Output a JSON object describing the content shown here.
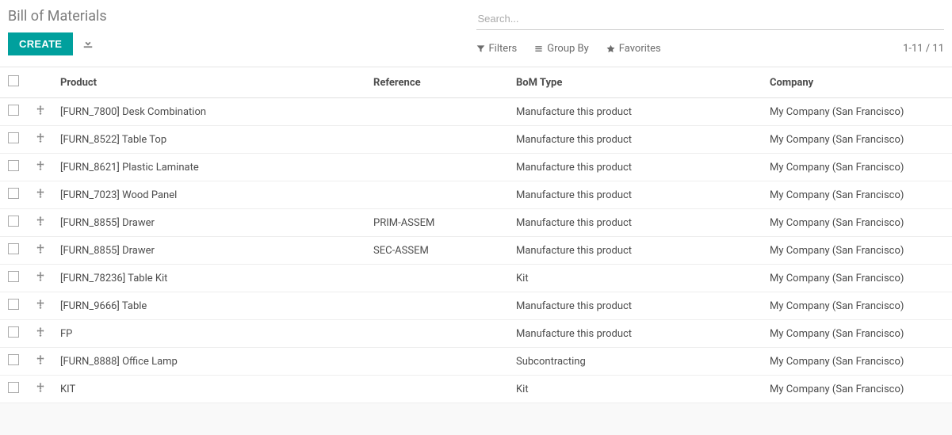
{
  "header": {
    "title": "Bill of Materials",
    "create_label": "CREATE"
  },
  "search": {
    "placeholder": "Search..."
  },
  "toolbar": {
    "filters": "Filters",
    "groupby": "Group By",
    "favorites": "Favorites",
    "pager": "1-11 / 11"
  },
  "columns": {
    "product": "Product",
    "reference": "Reference",
    "bom_type": "BoM Type",
    "company": "Company"
  },
  "rows": [
    {
      "product": "[FURN_7800] Desk Combination",
      "reference": "",
      "bom_type": "Manufacture this product",
      "company": "My Company (San Francisco)"
    },
    {
      "product": "[FURN_8522] Table Top",
      "reference": "",
      "bom_type": "Manufacture this product",
      "company": "My Company (San Francisco)"
    },
    {
      "product": "[FURN_8621] Plastic Laminate",
      "reference": "",
      "bom_type": "Manufacture this product",
      "company": "My Company (San Francisco)"
    },
    {
      "product": "[FURN_7023] Wood Panel",
      "reference": "",
      "bom_type": "Manufacture this product",
      "company": "My Company (San Francisco)"
    },
    {
      "product": "[FURN_8855] Drawer",
      "reference": "PRIM-ASSEM",
      "bom_type": "Manufacture this product",
      "company": "My Company (San Francisco)"
    },
    {
      "product": "[FURN_8855] Drawer",
      "reference": "SEC-ASSEM",
      "bom_type": "Manufacture this product",
      "company": "My Company (San Francisco)"
    },
    {
      "product": "[FURN_78236] Table Kit",
      "reference": "",
      "bom_type": "Kit",
      "company": "My Company (San Francisco)"
    },
    {
      "product": "[FURN_9666] Table",
      "reference": "",
      "bom_type": "Manufacture this product",
      "company": "My Company (San Francisco)"
    },
    {
      "product": "FP",
      "reference": "",
      "bom_type": "Manufacture this product",
      "company": "My Company (San Francisco)"
    },
    {
      "product": "[FURN_8888] Office Lamp",
      "reference": "",
      "bom_type": "Subcontracting",
      "company": "My Company (San Francisco)"
    },
    {
      "product": "KIT",
      "reference": "",
      "bom_type": "Kit",
      "company": "My Company (San Francisco)"
    }
  ]
}
